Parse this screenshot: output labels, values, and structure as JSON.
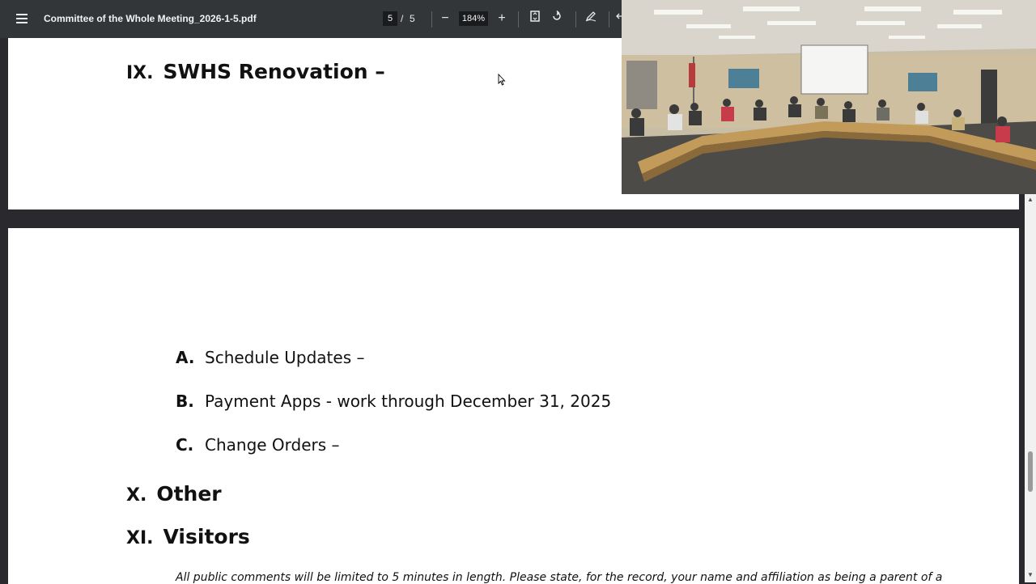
{
  "toolbar": {
    "title": "Committee of the Whole Meeting_2026-1-5.pdf",
    "current_page": "5",
    "page_separator": "/",
    "total_pages": "5",
    "zoom": "184%",
    "zoom_out_symbol": "−",
    "zoom_in_symbol": "+"
  },
  "document": {
    "section_ix": {
      "num": "IX.",
      "title": "SWHS Renovation –"
    },
    "items": [
      {
        "letter": "A.",
        "text": "Schedule Updates –"
      },
      {
        "letter": "B.",
        "text": "Payment Apps - work through December 31, 2025"
      },
      {
        "letter": "C.",
        "text": "Change Orders –"
      }
    ],
    "section_x": {
      "num": "X.",
      "title": "Other"
    },
    "section_xi": {
      "num": "XI.",
      "title": "Visitors"
    },
    "visitors_note": "All public comments will be limited to 5 minutes in length. Please state, for the record, your name and affiliation as being a parent of a"
  },
  "colors": {
    "toolbar_bg": "#323639",
    "viewer_bg": "#2a2a2e",
    "page_bg": "#ffffff"
  }
}
